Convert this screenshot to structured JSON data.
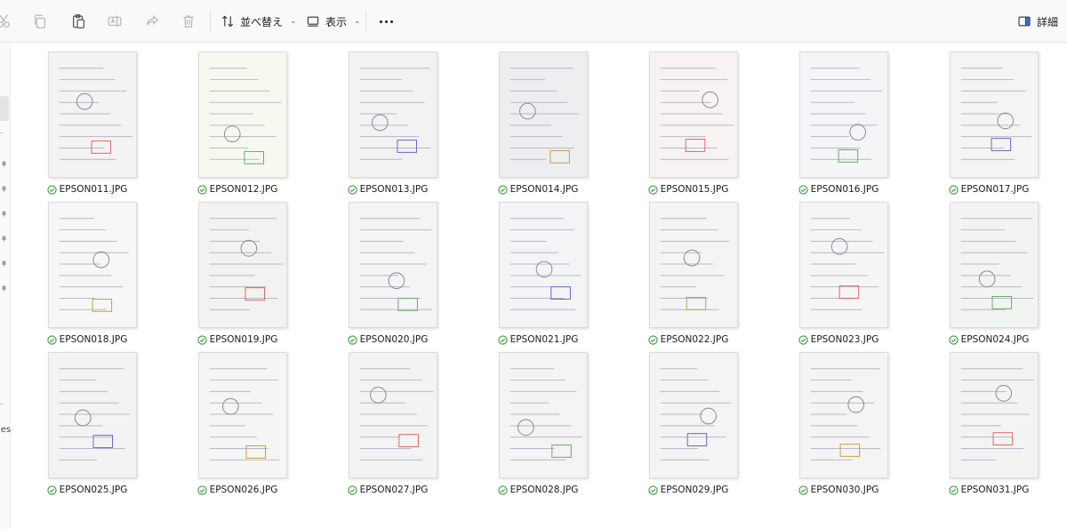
{
  "toolbar": {
    "sort_label": "並べ替え",
    "view_label": "表示",
    "details_label": "詳細",
    "icons": [
      "cut-icon",
      "copy-icon",
      "paste-icon",
      "rename-icon",
      "share-icon",
      "delete-icon"
    ]
  },
  "nav": {
    "partial_label": "les"
  },
  "colors": {
    "accent": "#2f7d32",
    "check_green": "#3a9a3a",
    "toolbar_bg": "#f9f9f9"
  },
  "files": [
    {
      "name": "EPSON011.JPG",
      "status": "synced",
      "tint": "#f3f3f3"
    },
    {
      "name": "EPSON012.JPG",
      "status": "synced",
      "tint": "#f6f8ef"
    },
    {
      "name": "EPSON013.JPG",
      "status": "synced",
      "tint": "#f2f2f2"
    },
    {
      "name": "EPSON014.JPG",
      "status": "synced",
      "tint": "#eceef0"
    },
    {
      "name": "EPSON015.JPG",
      "status": "synced",
      "tint": "#f7f3f3"
    },
    {
      "name": "EPSON016.JPG",
      "status": "synced",
      "tint": "#f3f5f7"
    },
    {
      "name": "EPSON017.JPG",
      "status": "synced",
      "tint": "#f4f4f2"
    },
    {
      "name": "EPSON018.JPG",
      "status": "synced",
      "tint": "#f6f6f6"
    },
    {
      "name": "EPSON019.JPG",
      "status": "synced",
      "tint": "#f2f2f0"
    },
    {
      "name": "EPSON020.JPG",
      "status": "synced",
      "tint": "#f4f4f4"
    },
    {
      "name": "EPSON021.JPG",
      "status": "synced",
      "tint": "#f3f4f6"
    },
    {
      "name": "EPSON022.JPG",
      "status": "synced",
      "tint": "#f4f4f4"
    },
    {
      "name": "EPSON023.JPG",
      "status": "synced",
      "tint": "#f6f5f5"
    },
    {
      "name": "EPSON024.JPG",
      "status": "synced",
      "tint": "#f1f4f1"
    },
    {
      "name": "EPSON025.JPG",
      "status": "synced",
      "tint": "#f3f3f3"
    },
    {
      "name": "EPSON026.JPG",
      "status": "synced",
      "tint": "#f5f5f3"
    },
    {
      "name": "EPSON027.JPG",
      "status": "synced",
      "tint": "#f3f3f3"
    },
    {
      "name": "EPSON028.JPG",
      "status": "synced",
      "tint": "#f5f3f3"
    },
    {
      "name": "EPSON029.JPG",
      "status": "synced",
      "tint": "#f4f4f4"
    },
    {
      "name": "EPSON030.JPG",
      "status": "synced",
      "tint": "#f4f4f4"
    },
    {
      "name": "EPSON031.JPG",
      "status": "synced",
      "tint": "#f2f4f2"
    }
  ]
}
